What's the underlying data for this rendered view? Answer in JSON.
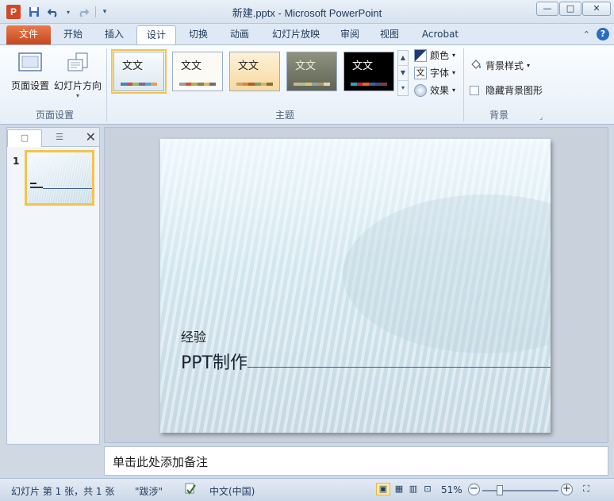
{
  "window": {
    "title": "新建.pptx - Microsoft PowerPoint",
    "app_icon_letter": "P",
    "qat": {
      "save_icon": "save-icon",
      "undo_icon": "undo-icon",
      "redo_icon": "redo-icon"
    },
    "controls": {
      "minimize": "—",
      "restore": "□",
      "close": "✕"
    }
  },
  "tabs": [
    {
      "label": "文件",
      "type": "file"
    },
    {
      "label": "开始"
    },
    {
      "label": "插入"
    },
    {
      "label": "设计",
      "active": true
    },
    {
      "label": "切换"
    },
    {
      "label": "动画"
    },
    {
      "label": "幻灯片放映"
    },
    {
      "label": "审阅"
    },
    {
      "label": "视图"
    },
    {
      "label": "Acrobat"
    }
  ],
  "ribbon": {
    "page_setup": {
      "group_label": "页面设置",
      "page_setup_button": "页面设置",
      "orientation_button": "幻灯片方向"
    },
    "themes": {
      "group_label": "主题",
      "items": [
        {
          "sample": "文文",
          "bg": "#f4f8fb"
        },
        {
          "sample": "文文",
          "bg": "#fbfaf4"
        },
        {
          "sample": "文文",
          "bg": "#fbe9c6"
        },
        {
          "sample": "文文",
          "bg": "#7c8070"
        },
        {
          "sample": "文文",
          "bg": "#000000"
        }
      ],
      "colors_button": "颜色",
      "fonts_button": "字体",
      "effects_button": "效果"
    },
    "background": {
      "group_label": "背景",
      "styles_button": "背景样式",
      "hide_graphics_label": "隐藏背景图形"
    }
  },
  "slides_pane": {
    "thumbnail_number": "1",
    "close": "✕"
  },
  "slide": {
    "subtitle": "经验",
    "title": "PPT制作"
  },
  "notes": {
    "placeholder": "单击此处添加备注"
  },
  "status": {
    "slide_info": "幻灯片 第 1 张，共 1 张",
    "theme_name": "\"跋涉\"",
    "language": "中文(中国)",
    "zoom": "51%"
  }
}
